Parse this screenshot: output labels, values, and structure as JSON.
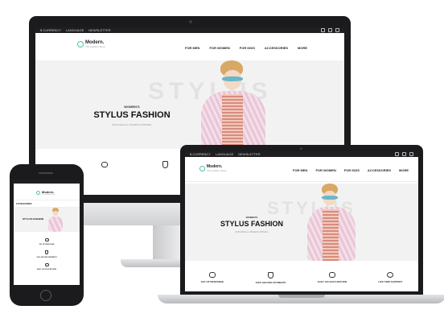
{
  "desktop": {
    "topbar": {
      "currency": "$ CURRENCY",
      "language": "LANGUAGE",
      "newsletter": "NEWSLETTER"
    },
    "logo": {
      "name": "Modern.",
      "tagline": "The Fashion Store"
    },
    "nav": [
      "FOR MEN",
      "FOR WOMEN",
      "FOR KIDS",
      "ACCESSORIES",
      "MORE"
    ],
    "hero": {
      "watermark": "STYLUS",
      "eyebrow": "WOMEN'S",
      "title": "STYLUS FASHION",
      "subtitle": "EXPLORE ALL WOMENS APPAREL"
    }
  },
  "laptop": {
    "topbar": {
      "currency": "$ CURRENCY",
      "language": "LANGUAGE",
      "newsletter": "NEWSLETTER"
    },
    "logo": {
      "name": "Modern.",
      "tagline": "The Fashion Store"
    },
    "nav": [
      "FOR MEN",
      "FOR WOMEN",
      "FOR KIDS",
      "ACCESSORIES",
      "MORE"
    ],
    "hero": {
      "watermark": "STYLUS",
      "eyebrow": "WOMEN'S",
      "title": "STYLUS FASHION",
      "subtitle": "EXPLORE ALL WOMENS APPAREL"
    },
    "features": [
      "24/7 UP RESPONSE",
      "100% SECURE PAYMENTS",
      "EASY 100 DAYS RETURN",
      "LIFE TIME SUPPORT"
    ]
  },
  "phone": {
    "logo": {
      "name": "Modern.",
      "tagline": "The Fashion Store"
    },
    "categories_label": "CATEGORIES",
    "hero": {
      "title": "STYLUS FASHION"
    },
    "features": [
      "24/7 UP RESPONSE",
      "100% SECURE PAYMENTS",
      "EASY 100 DAYS RETURN"
    ]
  },
  "icons": [
    "search-icon",
    "user-icon",
    "cart-icon",
    "shield-icon",
    "chat-icon",
    "support-icon"
  ],
  "colors": {
    "accent": "#4bc3b2",
    "frame": "#1b1b1d",
    "hero_bg": "#f2f2f2"
  }
}
